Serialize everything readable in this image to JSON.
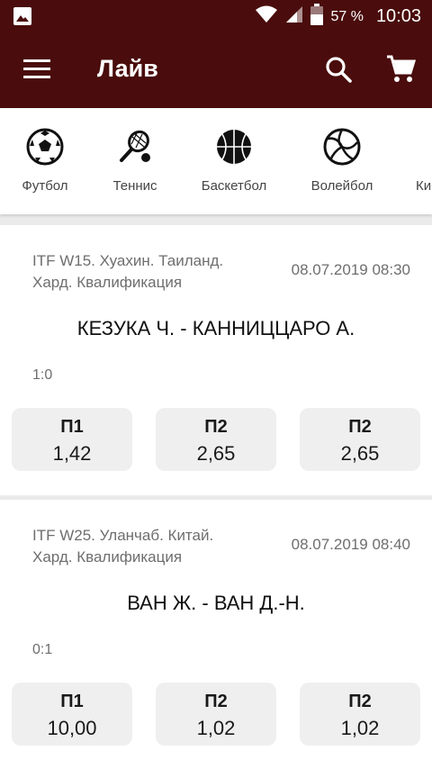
{
  "status_bar": {
    "battery": "57 %",
    "time": "10:03",
    "icons": [
      "image-icon",
      "wifi-icon",
      "signal-icon",
      "battery-icon"
    ]
  },
  "app_bar": {
    "title": "Лайв",
    "background": "#4a0c0c",
    "icons": [
      "menu-icon",
      "search-icon",
      "cart-icon"
    ]
  },
  "sports": [
    {
      "label": "Футбол",
      "icon": "soccer-ball-icon"
    },
    {
      "label": "Теннис",
      "icon": "tennis-racket-icon"
    },
    {
      "label": "Баскетбол",
      "icon": "basketball-icon"
    },
    {
      "label": "Волейбол",
      "icon": "volleyball-icon"
    },
    {
      "label": "Ки",
      "icon": ""
    }
  ],
  "events": [
    {
      "league_line1": "ITF W15. Хуахин. Таиланд.",
      "league_line2": "Хард. Квалификация",
      "datetime": "08.07.2019 08:30",
      "teams": "КЕЗУКА Ч. - КАННИЦЦАРО  А.",
      "score": "1:0",
      "odds": [
        {
          "label": "П1",
          "value": "1,42"
        },
        {
          "label": "П2",
          "value": "2,65"
        },
        {
          "label": "П2",
          "value": "2,65"
        }
      ]
    },
    {
      "league_line1": "ITF W25. Уланчаб. Китай.",
      "league_line2": "Хард. Квалификация",
      "datetime": "08.07.2019 08:40",
      "teams": "ВАН Ж. - ВАН Д.-Н.",
      "score": "0:1",
      "odds": [
        {
          "label": "П1",
          "value": "10,00"
        },
        {
          "label": "П2",
          "value": "1,02"
        },
        {
          "label": "П2",
          "value": "1,02"
        }
      ]
    }
  ]
}
